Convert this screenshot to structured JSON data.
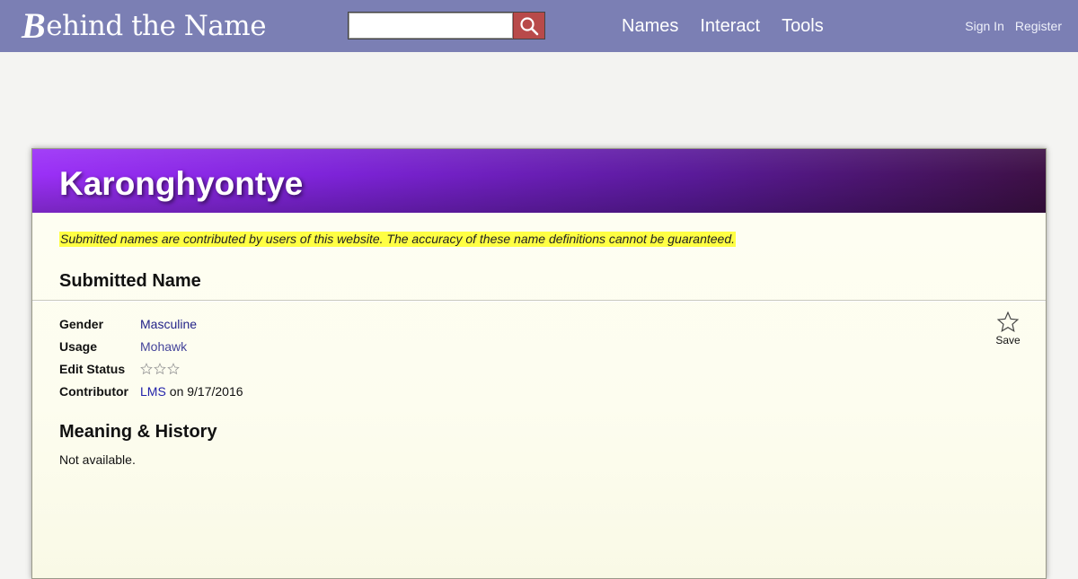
{
  "header": {
    "logo_initial": "B",
    "logo_rest": "ehind the Name",
    "search": {
      "value": "",
      "placeholder": ""
    },
    "search_icon": "magnifier-icon",
    "nav": [
      "Names",
      "Interact",
      "Tools"
    ],
    "account": [
      "Sign In",
      "Register"
    ],
    "colors": {
      "bar": "#7b7fb4",
      "search_button": "#b84a4a"
    }
  },
  "card": {
    "name": "Karonghyontye",
    "disclaimer": "Submitted names are contributed by users of this website. The accuracy of these name definitions cannot be guaranteed.",
    "section_title": "Submitted Name",
    "info": {
      "gender_label": "Gender",
      "gender_value": "Masculine",
      "usage_label": "Usage",
      "usage_value": "Mohawk",
      "edit_status_label": "Edit Status",
      "edit_status_icon": "star-outline-icon",
      "contributor_label": "Contributor",
      "contributor_value": "LMS",
      "contributor_suffix": "on 9/17/2016"
    },
    "save_label": "Save",
    "save_icon": "star-outline-icon",
    "meaning_title": "Meaning & History",
    "meaning_text": "Not available.",
    "colors": {
      "header_start": "#9b30f7",
      "header_end": "#3d1045",
      "disclaimer_highlight": "#ffff44"
    }
  }
}
